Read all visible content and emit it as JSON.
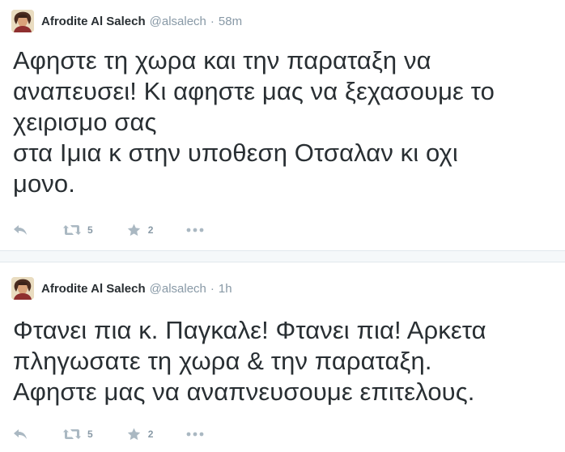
{
  "tweets": [
    {
      "name": "Afrodite Al Salech",
      "handle": "@alsalech",
      "separator": "·",
      "time": "58m",
      "lines": [
        "Αφηστε τη χωρα και την παραταξη να",
        "αναπευσει! Κι αφηστε μας να ξεχασουμε το",
        "χειρισμο σας",
        "στα Ιμια κ στην υποθεση Οτσαλαν κι οχι",
        "μονο."
      ],
      "retweets": "5",
      "favorites": "2"
    },
    {
      "name": "Afrodite Al Salech",
      "handle": "@alsalech",
      "separator": "·",
      "time": "1h",
      "lines": [
        "Φτανει πια κ. Παγκαλε! Φτανει πια! Αρκετα",
        "πληγωσατε τη χωρα & την παραταξη.",
        "Αφηστε μας να αναπνευσουμε επιτελους."
      ],
      "retweets": "5",
      "favorites": "2"
    }
  ],
  "icons": {
    "reply": "reply-icon",
    "retweet": "retweet-icon",
    "favorite": "star-icon",
    "more": "more-icon"
  },
  "colors": {
    "text": "#292f33",
    "secondary": "#8899a6",
    "action": "#aab8c2",
    "divider": "#e1e8ed"
  }
}
